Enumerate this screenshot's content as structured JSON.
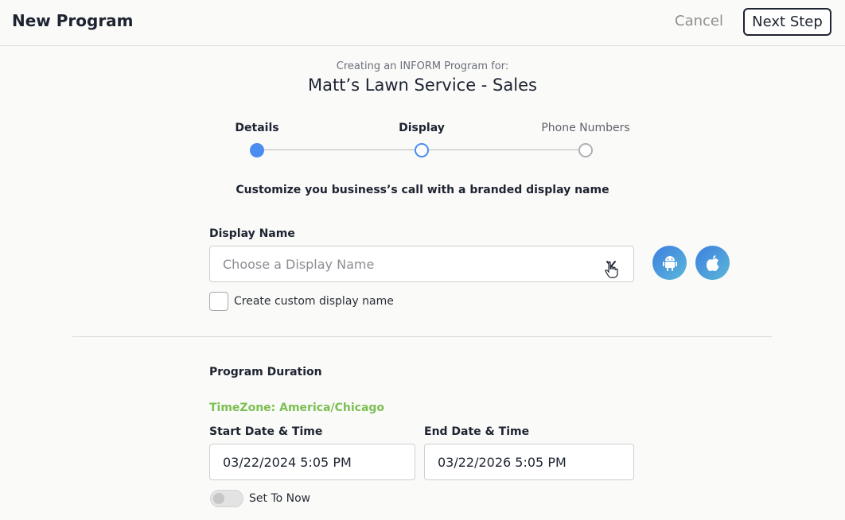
{
  "header": {
    "title": "New Program",
    "cancel_label": "Cancel",
    "next_label": "Next Step"
  },
  "intro": {
    "creating_for": "Creating an INFORM Program for:",
    "company": "Matt’s Lawn Service - Sales"
  },
  "steps": [
    {
      "label": "Details",
      "state": "complete"
    },
    {
      "label": "Display",
      "state": "current"
    },
    {
      "label": "Phone Numbers",
      "state": "upcoming"
    }
  ],
  "display": {
    "subtitle": "Customize you business’s call with a branded display name",
    "label": "Display Name",
    "placeholder": "Choose a Display Name",
    "custom_checkbox_label": "Create custom display name",
    "custom_checked": false,
    "os_buttons": [
      "android-icon",
      "apple-icon"
    ]
  },
  "duration": {
    "section_title": "Program Duration",
    "timezone": "TimeZone: America/Chicago",
    "start_label": "Start Date & Time",
    "start_value": "03/22/2024 5:05 PM",
    "end_label": "End Date & Time",
    "end_value": "03/22/2026 5:05 PM",
    "set_to_now_label": "Set To Now",
    "set_to_now_on": false
  },
  "colors": {
    "accent": "#4a8cf0",
    "timezone": "#7cbf52",
    "heading": "#1d2330"
  }
}
